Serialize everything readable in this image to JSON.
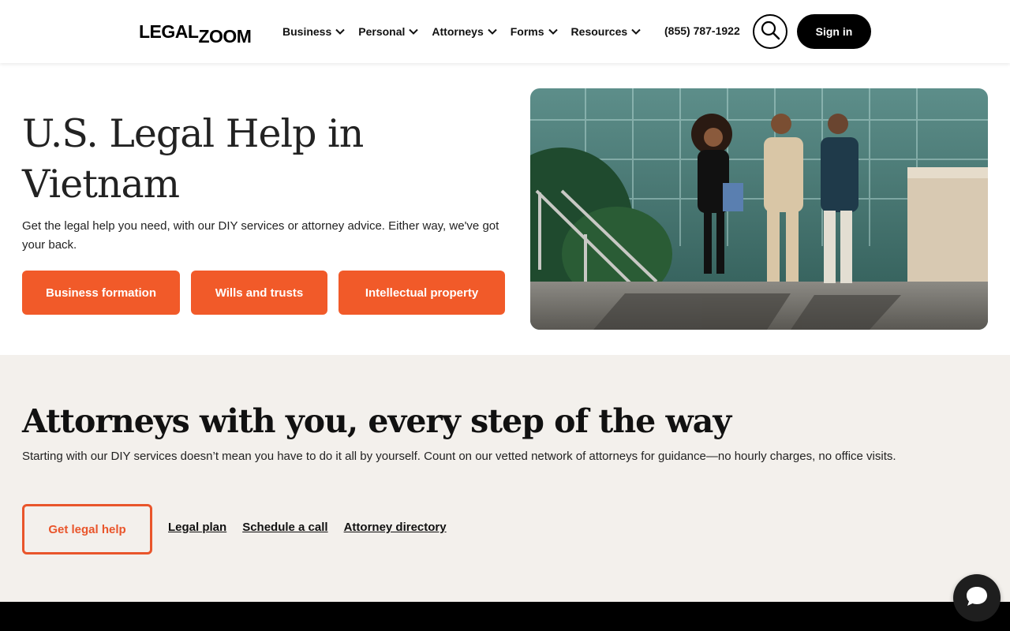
{
  "header": {
    "logo_part1": "LEGAL",
    "logo_part2": "ZOOM",
    "nav": [
      {
        "label": "Business"
      },
      {
        "label": "Personal"
      },
      {
        "label": "Attorneys"
      },
      {
        "label": "Forms"
      },
      {
        "label": "Resources"
      }
    ],
    "phone": "(855) 787-1922",
    "search_icon": "search-icon",
    "signin_label": "Sign in"
  },
  "hero": {
    "title": "U.S. Legal Help in Vietnam",
    "subtitle": "Get the legal help you need, with our DIY services or attorney advice. Either way, we've got your back.",
    "buttons": [
      {
        "label": "Business formation"
      },
      {
        "label": "Wills and trusts"
      },
      {
        "label": "Intellectual property"
      }
    ]
  },
  "attorneys": {
    "title": "Attorneys with you, every step of the way",
    "subtitle": "Starting with our DIY services doesn’t mean you have to do it all by yourself. Count on our vetted network of attorneys for guidance—no hourly charges, no office visits.",
    "primary_button": "Get legal help",
    "links": [
      {
        "label": "Legal plan"
      },
      {
        "label": "Schedule a call"
      },
      {
        "label": "Attorney directory"
      }
    ]
  },
  "chat_icon": "chat-bubble-icon",
  "colors": {
    "accent": "#f15a29",
    "section_bg": "#f3f0ec",
    "dark": "#000000"
  }
}
